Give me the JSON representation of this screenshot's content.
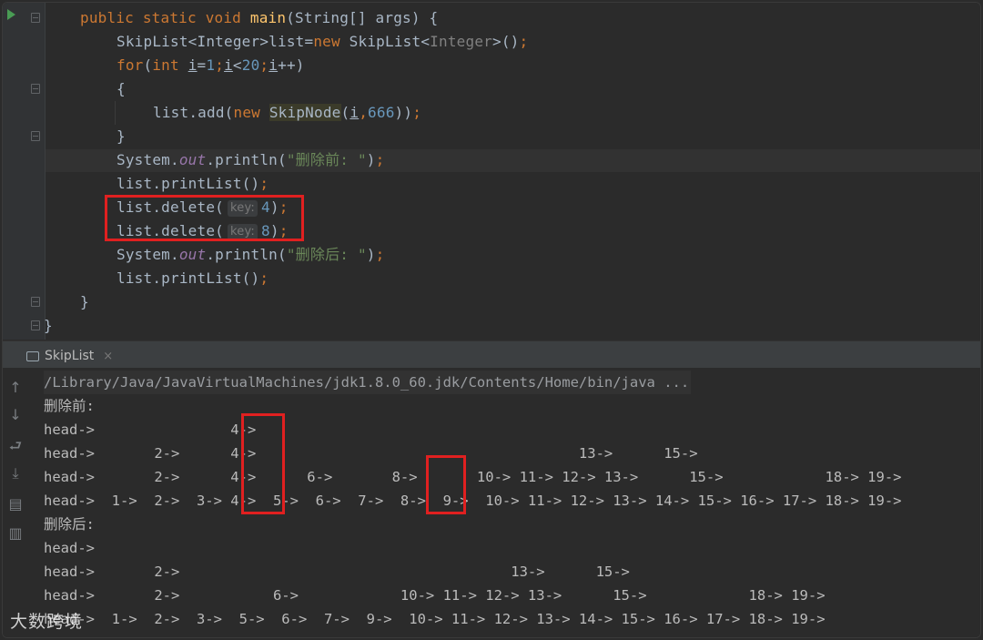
{
  "editor": {
    "lines": [
      [
        "kw:public ",
        "kw:static ",
        "kw:void ",
        "fn:main",
        "t:(String[] args) {"
      ],
      [
        "t:SkipList<Integer>list=",
        "kw:new ",
        "t:SkipList<",
        "gen:Integer",
        "t:>()",
        "kw:;"
      ],
      [
        "kw:for",
        "t:(",
        "kw:int ",
        "ul:i",
        "t:=",
        "num:1",
        "kw:;",
        "ul:i",
        "t:<",
        "num:20",
        "kw:;",
        "ul:i",
        "t:++)"
      ],
      [
        "t:{"
      ],
      [
        "t:list.add(",
        "kw:new ",
        "hl:SkipNode",
        "t:(",
        "ul:i",
        "kw:,",
        "num:666",
        "t:))",
        "kw:;"
      ],
      [
        "t:}"
      ],
      [
        "t:System.",
        "field:out",
        "t:.println(",
        "str:\"删除前: \"",
        "t:)",
        "kw:;"
      ],
      [
        "t:list.printList()",
        "kw:;"
      ],
      [
        "t:list.delete(",
        "hint:key:",
        "num:4",
        "t:)",
        "kw:;"
      ],
      [
        "t:list.delete(",
        "hint:key:",
        "num:8",
        "t:)",
        "kw:;"
      ],
      [
        "t:System.",
        "field:out",
        "t:.println(",
        "str:\"删除后: \"",
        "t:)",
        "kw:;"
      ],
      [
        "t:list.printList()",
        "kw:;"
      ],
      [
        "t:}"
      ],
      [
        "t:}"
      ]
    ]
  },
  "run_panel": {
    "tab_label": "SkipList",
    "tab_close": "×",
    "command": "/Library/Java/JavaVirtualMachines/jdk1.8.0_60.jdk/Contents/Home/bin/java ...",
    "before_label": "删除前:",
    "before_rows": [
      "head->                4->",
      "head->       2->      4->                                      13->      15->",
      "head->       2->      4->      6->       8->       10-> 11-> 12-> 13->      15->            18-> 19->",
      "head->  1->  2->  3-> 4->  5->  6->  7->  8->  9->  10-> 11-> 12-> 13-> 14-> 15-> 16-> 17-> 18-> 19->"
    ],
    "after_label": "删除后:",
    "after_rows": [
      "head->",
      "head->       2->                                       13->      15->",
      "head->       2->           6->            10-> 11-> 12-> 13->      15->            18-> 19->",
      "head->  1->  2->  3->  5->  6->  7->  9->  10-> 11-> 12-> 13-> 14-> 15-> 16-> 17-> 18-> 19->"
    ]
  },
  "watermark": "大数跨境",
  "colors": {
    "editor_bg": "#2b2b2b",
    "keyword": "#cc7832",
    "method": "#ffc66d",
    "number": "#6897bb",
    "string": "#6a8759",
    "highlight_box": "#e02020"
  },
  "icons": [
    "run-gutter-icon",
    "fold-icon",
    "console-tab-icon",
    "up-arrow-icon",
    "down-arrow-icon",
    "soft-wrap-icon",
    "scroll-to-end-icon",
    "print-icon",
    "trash-icon"
  ]
}
